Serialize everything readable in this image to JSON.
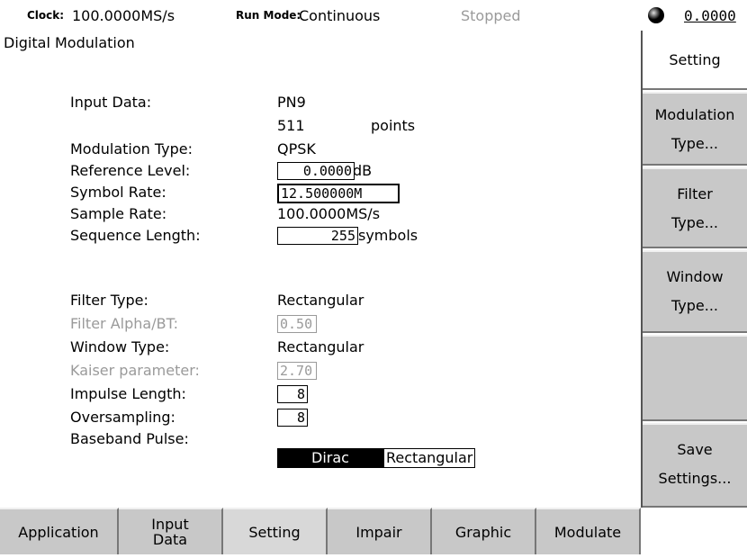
{
  "status_bar": {
    "clock_label": "Clock:",
    "clock_value": "100.0000MS/s",
    "run_mode_label": "Run Mode:",
    "run_mode_value": "Continuous",
    "state": "Stopped",
    "indicator_icon": "status-dot-icon",
    "value": "0.0000"
  },
  "panel": {
    "title": "Digital Modulation",
    "input_data": {
      "label": "Input Data:",
      "value": "PN9",
      "points_value": "511",
      "points_unit": "points"
    },
    "modulation_type": {
      "label": "Modulation Type:",
      "value": "QPSK"
    },
    "reference_level": {
      "label": "Reference Level:",
      "value": "0.0000",
      "unit": "dB"
    },
    "symbol_rate": {
      "label": "Symbol Rate:",
      "value": "12.500000M"
    },
    "sample_rate": {
      "label": "Sample Rate:",
      "value": "100.0000MS/s"
    },
    "sequence_length": {
      "label": "Sequence Length:",
      "value": "255",
      "unit": "symbols"
    },
    "filter_type": {
      "label": "Filter Type:",
      "value": "Rectangular"
    },
    "filter_alpha": {
      "label": "Filter Alpha/BT:",
      "value": "0.50"
    },
    "window_type": {
      "label": "Window Type:",
      "value": "Rectangular"
    },
    "kaiser_parameter": {
      "label": "Kaiser parameter:",
      "value": "2.70"
    },
    "impulse_length": {
      "label": "Impulse Length:",
      "value": "8"
    },
    "oversampling": {
      "label": "Oversampling:",
      "value": "8"
    },
    "baseband_pulse": {
      "label": "Baseband Pulse:",
      "option_selected": "Dirac",
      "option_other": "Rectangular"
    }
  },
  "side_menu": {
    "title": "Setting",
    "modulation_type": [
      "Modulation",
      "Type..."
    ],
    "filter_type": [
      "Filter",
      "Type..."
    ],
    "window_type": [
      "Window",
      "Type..."
    ],
    "save_settings": [
      "Save",
      "Settings..."
    ]
  },
  "bottom_tabs": {
    "application": "Application",
    "input_data": [
      "Input",
      "Data"
    ],
    "setting": "Setting",
    "impair": "Impair",
    "graphic": "Graphic",
    "modulate": "Modulate"
  },
  "colors": {
    "button_gray": "#c8c8c8",
    "disabled_text": "#9a9a9a",
    "selected_bg": "#000000"
  }
}
